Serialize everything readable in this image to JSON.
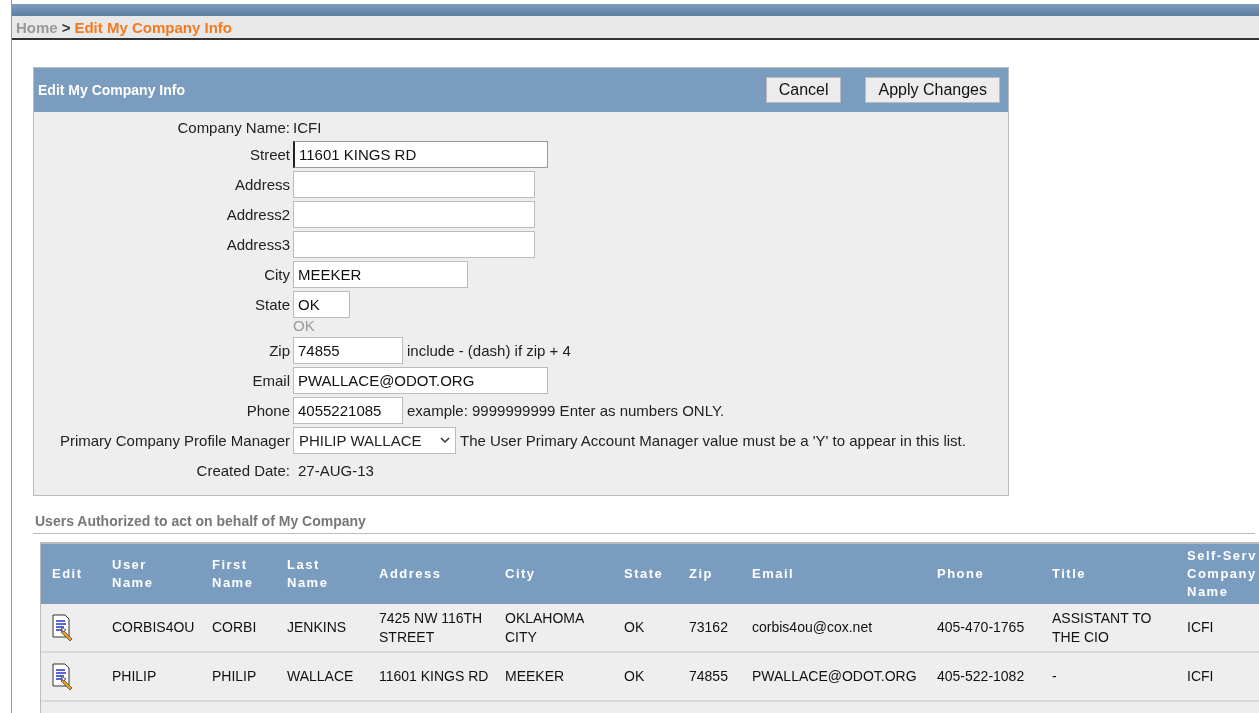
{
  "breadcrumb": {
    "home": "Home",
    "separator": ">",
    "current": "Edit My Company Info"
  },
  "panel": {
    "title": "Edit My Company Info",
    "buttons": [
      "Cancel",
      "Apply Changes"
    ],
    "fields": [
      {
        "kind": "text",
        "label": "Company Name:",
        "value": "ICFI"
      },
      {
        "kind": "input",
        "label": "Street",
        "value": "11601 KINGS RD",
        "focused": true
      },
      {
        "kind": "input",
        "label": "Address"
      },
      {
        "kind": "input",
        "label": "Address2"
      },
      {
        "kind": "input",
        "label": "Address3"
      },
      {
        "kind": "input",
        "label": "City",
        "value": "MEEKER"
      },
      {
        "kind": "input",
        "label": "State",
        "value": "OK",
        "hint": "OK"
      },
      {
        "kind": "input",
        "label": "Zip",
        "value": "74855",
        "note": "include - (dash) if zip + 4"
      },
      {
        "kind": "input",
        "label": "Email",
        "value": "PWALLACE@ODOT.ORG"
      },
      {
        "kind": "input",
        "label": "Phone",
        "value": "4055221085",
        "note": "example: 9999999999 Enter as numbers ONLY."
      },
      {
        "kind": "select",
        "label": "Primary Company Profile Manager",
        "value": "PHILIP WALLACE",
        "note": "The User Primary Account Manager value must be a 'Y' to appear in this list."
      },
      {
        "kind": "text",
        "label": "Created Date:",
        "value": "27-AUG-13"
      }
    ]
  },
  "users": {
    "title": "Users Authorized to act on behalf of My Company",
    "columns": [
      "Edit",
      "User Name",
      "First Name",
      "Last Name",
      "Address",
      "City",
      "State",
      "Zip",
      "Email",
      "Phone",
      "Title",
      "Self-Serv Company Name"
    ],
    "rows": [
      [
        "",
        "CORBIS4OU",
        "CORBI",
        "JENKINS",
        "7425 NW 116TH STREET",
        "OKLAHOMA CITY",
        "OK",
        "73162",
        "corbis4ou@cox.net",
        "405-470-1765",
        "ASSISTANT TO THE CIO",
        "ICFI"
      ],
      [
        "",
        "PHILIP",
        "PHILIP",
        "WALLACE",
        "11601 KINGS RD",
        "MEEKER",
        "OK",
        "74855",
        "PWALLACE@ODOT.ORG",
        "405-522-1082",
        "-",
        "ICFI"
      ]
    ]
  }
}
